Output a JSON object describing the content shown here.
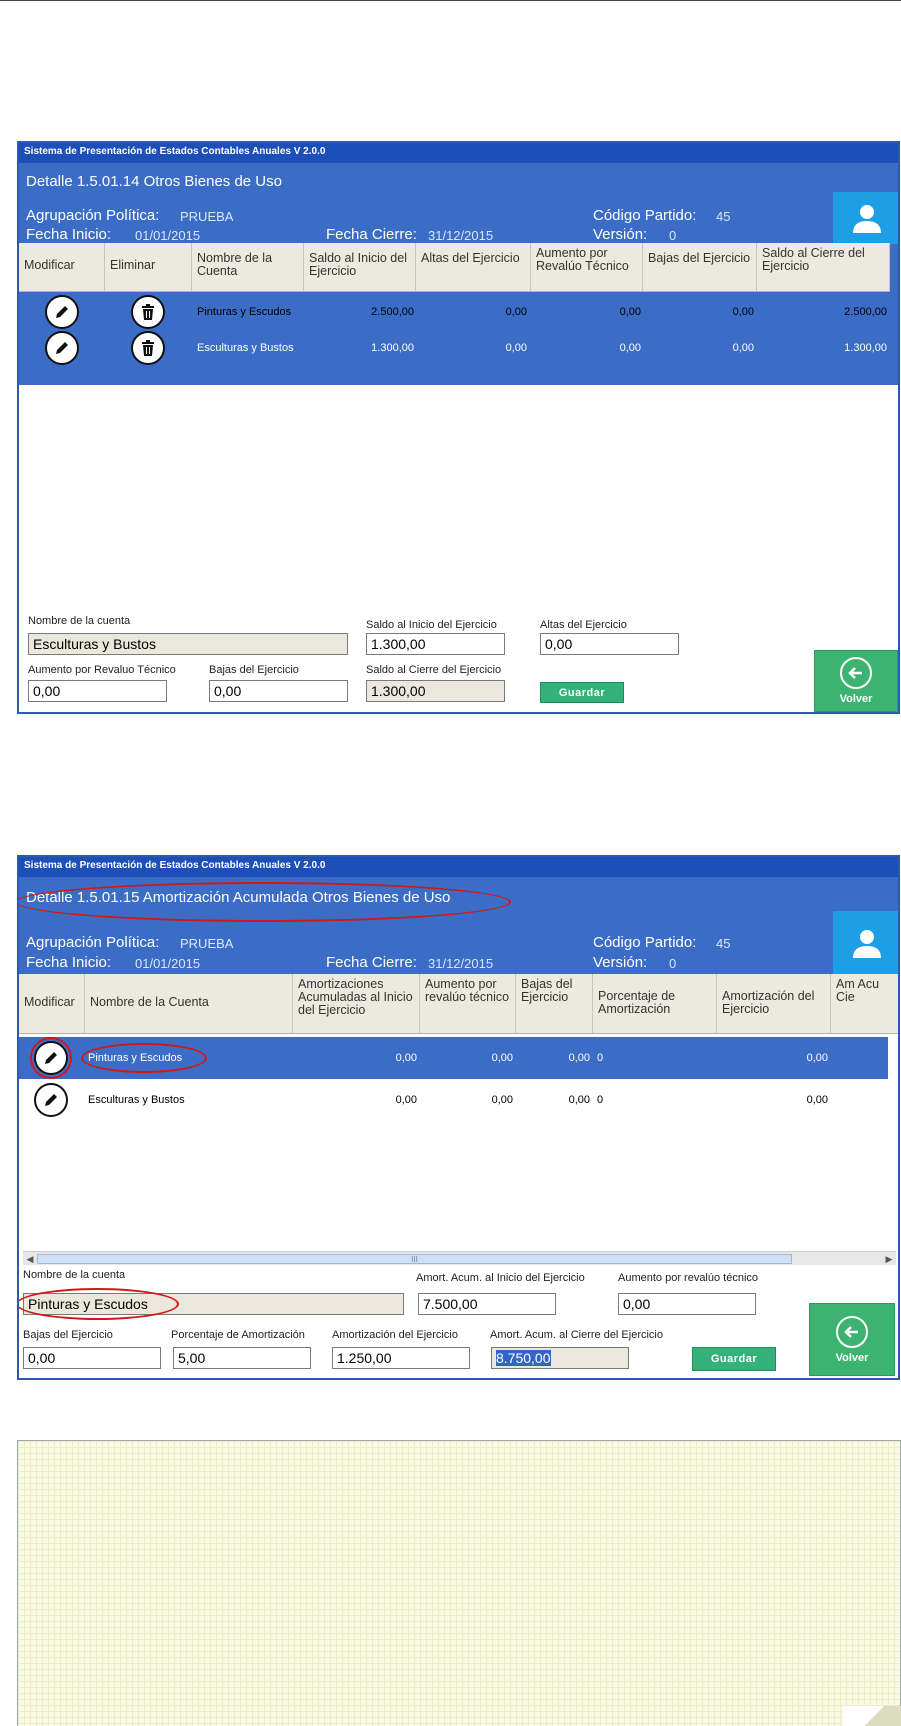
{
  "window_title": "Sistema de Presentación de Estados Contables Anuales V 2.0.0",
  "screen1": {
    "heading": "Detalle 1.5.01.14 Otros Bienes de Uso",
    "agrupacion_label": "Agrupación Política:",
    "agrupacion_value": "PRUEBA",
    "fecha_inicio_label": "Fecha Inicio:",
    "fecha_inicio_value": "01/01/2015",
    "fecha_cierre_label": "Fecha Cierre:",
    "fecha_cierre_value": "31/12/2015",
    "codigo_label": "Código Partido:",
    "codigo_value": "45",
    "version_label": "Versión:",
    "version_value": "0",
    "columns": [
      "Modificar",
      "Eliminar",
      "Nombre de la Cuenta",
      "Saldo al Inicio del Ejercicio",
      "Altas del Ejercicio",
      "Aumento por Revalúo Técnico",
      "Bajas del Ejercicio",
      "Saldo al Cierre del Ejercicio"
    ],
    "rows": [
      {
        "nombre": "Pinturas y Escudos",
        "saldo_inicio": "2.500,00",
        "altas": "0,00",
        "aumento": "0,00",
        "bajas": "0,00",
        "saldo_cierre": "2.500,00"
      },
      {
        "nombre": "Esculturas y Bustos",
        "saldo_inicio": "1.300,00",
        "altas": "0,00",
        "aumento": "0,00",
        "bajas": "0,00",
        "saldo_cierre": "1.300,00"
      }
    ],
    "form": {
      "nombre_label": "Nombre de la cuenta",
      "nombre_value": "Esculturas y Bustos",
      "saldo_inicio_label": "Saldo al Inicio del Ejercicio",
      "saldo_inicio_value": "1.300,00",
      "altas_label": "Altas del Ejercicio",
      "altas_value": "0,00",
      "aumento_label": "Aumento por Revaluo Técnico",
      "aumento_value": "0,00",
      "bajas_label": "Bajas del Ejercicio",
      "bajas_value": "0,00",
      "saldo_cierre_label": "Saldo al Cierre del Ejercicio",
      "saldo_cierre_value": "1.300,00",
      "guardar_label": "Guardar",
      "volver_label": "Volver"
    }
  },
  "screen2": {
    "heading": "Detalle 1.5.01.15 Amortización Acumulada Otros Bienes de Uso",
    "agrupacion_label": "Agrupación Política:",
    "agrupacion_value": "PRUEBA",
    "fecha_inicio_label": "Fecha Inicio:",
    "fecha_inicio_value": "01/01/2015",
    "fecha_cierre_label": "Fecha Cierre:",
    "fecha_cierre_value": "31/12/2015",
    "codigo_label": "Código Partido:",
    "codigo_value": "45",
    "version_label": "Versión:",
    "version_value": "0",
    "columns": [
      "Modificar",
      "Nombre de la Cuenta",
      "Amortizaciones Acumuladas al Inicio del Ejercicio",
      "Aumento por revalúo técnico",
      "Bajas del Ejercicio",
      "Porcentaje de Amortización",
      "Amortización del Ejercicio",
      "Am Acu Cie"
    ],
    "rows": [
      {
        "nombre": "Pinturas y Escudos",
        "amort_inicio": "0,00",
        "aumento": "0,00",
        "bajas": "0,00",
        "porcentaje": "0",
        "amort_ejercicio": "0,00"
      },
      {
        "nombre": "Esculturas y Bustos",
        "amort_inicio": "0,00",
        "aumento": "0,00",
        "bajas": "0,00",
        "porcentaje": "0",
        "amort_ejercicio": "0,00"
      }
    ],
    "scroll_grip": "III",
    "form": {
      "nombre_label": "Nombre de la cuenta",
      "nombre_value": "Pinturas y Escudos",
      "amort_inicio_label": "Amort. Acum. al Inicio del Ejercicio",
      "amort_inicio_value": "7.500,00",
      "aumento_label": "Aumento por revalúo técnico",
      "aumento_value": "0,00",
      "bajas_label": "Bajas del Ejercicio",
      "bajas_value": "0,00",
      "porcentaje_label": "Porcentaje de Amortización",
      "porcentaje_value": "5,00",
      "amort_ejercicio_label": "Amortización del Ejercicio",
      "amort_ejercicio_value": "1.250,00",
      "amort_cierre_label": "Amort. Acum. al Cierre del Ejercicio",
      "amort_cierre_value": "8.750,00",
      "guardar_label": "Guardar",
      "volver_label": "Volver"
    }
  }
}
